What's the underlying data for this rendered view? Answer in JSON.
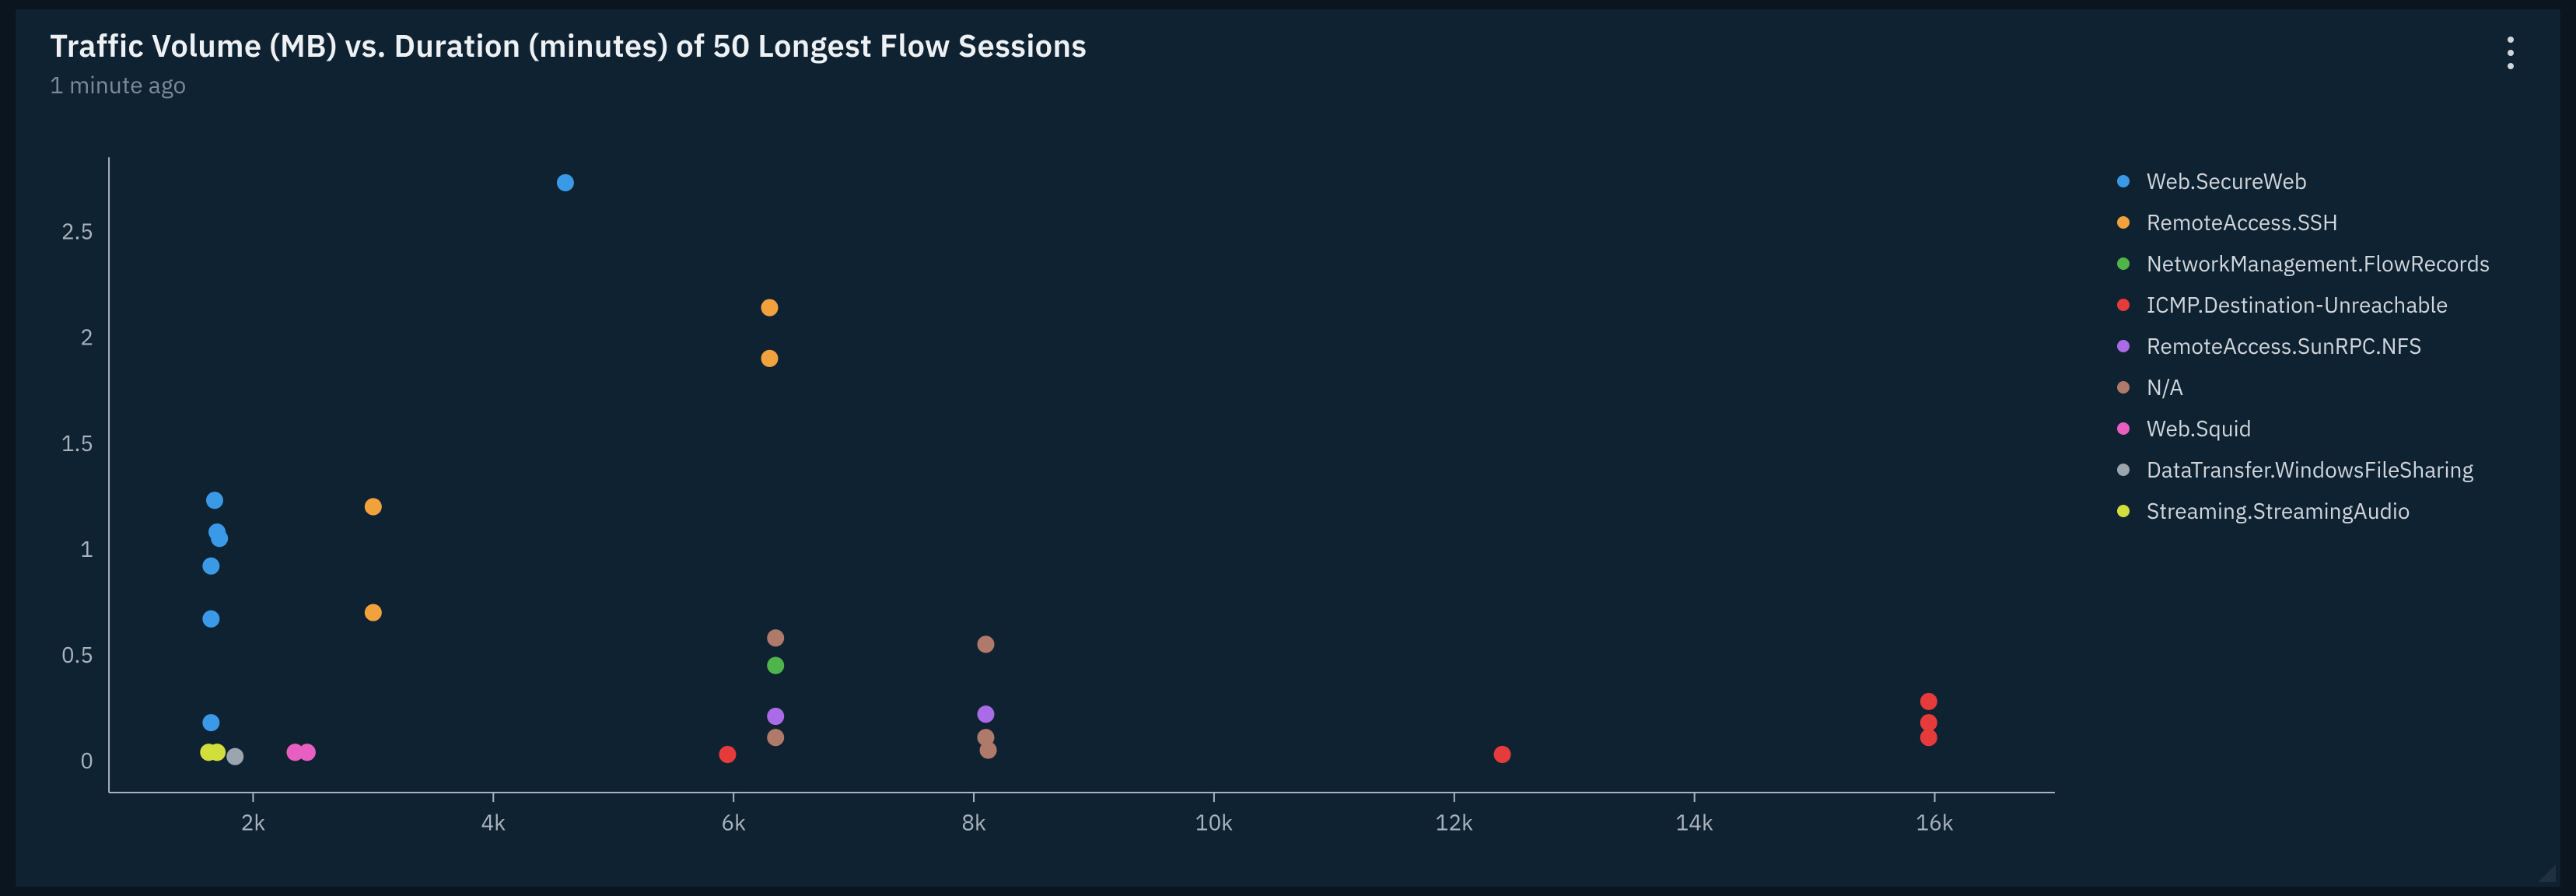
{
  "header": {
    "title": "Traffic Volume (MB) vs. Duration (minutes) of 50 Longest Flow Sessions",
    "subtitle": "1 minute ago"
  },
  "legend": [
    {
      "key": "Web.SecureWeb",
      "label": "Web.SecureWeb",
      "color": "#3a9ae8"
    },
    {
      "key": "RemoteAccess.SSH",
      "label": "RemoteAccess.SSH",
      "color": "#f2a23c"
    },
    {
      "key": "NetworkManagement.FlowRecords",
      "label": "NetworkManagement.FlowRecords",
      "color": "#4fb54a"
    },
    {
      "key": "ICMP.Destination-Unreachable",
      "label": "ICMP.Destination-Unreachable",
      "color": "#e63b3b"
    },
    {
      "key": "RemoteAccess.SunRPC.NFS",
      "label": "RemoteAccess.SunRPC.NFS",
      "color": "#a96ce6"
    },
    {
      "key": "N/A",
      "label": "N/A",
      "color": "#b07a6a"
    },
    {
      "key": "Web.Squid",
      "label": "Web.Squid",
      "color": "#e85ec1"
    },
    {
      "key": "DataTransfer.WindowsFileSharing",
      "label": "DataTransfer.WindowsFileSharing",
      "color": "#9aa5ad"
    },
    {
      "key": "Streaming.StreamingAudio",
      "label": "Streaming.StreamingAudio",
      "color": "#d2de3b"
    }
  ],
  "chart_data": {
    "type": "scatter",
    "xlabel": "",
    "ylabel": "",
    "title": "Traffic Volume (MB) vs. Duration (minutes) of 50 Longest Flow Sessions",
    "xlim": [
      800,
      17000
    ],
    "ylim": [
      -0.15,
      2.85
    ],
    "x_ticks": [
      2000,
      4000,
      6000,
      8000,
      10000,
      12000,
      14000,
      16000
    ],
    "x_tick_labels": [
      "2k",
      "4k",
      "6k",
      "8k",
      "10k",
      "12k",
      "14k",
      "16k"
    ],
    "y_ticks": [
      0,
      0.5,
      1,
      1.5,
      2,
      2.5
    ],
    "y_tick_labels": [
      "0",
      "0.5",
      "1",
      "1.5",
      "2",
      "2.5"
    ],
    "series": {
      "Web.SecureWeb": [
        {
          "x": 1650,
          "y": 0.18
        },
        {
          "x": 1650,
          "y": 0.67
        },
        {
          "x": 1650,
          "y": 0.92
        },
        {
          "x": 1700,
          "y": 1.08
        },
        {
          "x": 1720,
          "y": 1.05
        },
        {
          "x": 1680,
          "y": 1.23
        },
        {
          "x": 4600,
          "y": 2.73
        }
      ],
      "RemoteAccess.SSH": [
        {
          "x": 3000,
          "y": 0.7
        },
        {
          "x": 3000,
          "y": 1.2
        },
        {
          "x": 6300,
          "y": 1.9
        },
        {
          "x": 6300,
          "y": 2.14
        }
      ],
      "NetworkManagement.FlowRecords": [
        {
          "x": 6350,
          "y": 0.45
        }
      ],
      "ICMP.Destination-Unreachable": [
        {
          "x": 5950,
          "y": 0.03
        },
        {
          "x": 12400,
          "y": 0.03
        },
        {
          "x": 15950,
          "y": 0.11
        },
        {
          "x": 15950,
          "y": 0.18
        },
        {
          "x": 15950,
          "y": 0.28
        }
      ],
      "RemoteAccess.SunRPC.NFS": [
        {
          "x": 6350,
          "y": 0.21
        },
        {
          "x": 8100,
          "y": 0.22
        }
      ],
      "N/A": [
        {
          "x": 1700,
          "y": 0.04
        },
        {
          "x": 6350,
          "y": 0.11
        },
        {
          "x": 6350,
          "y": 0.58
        },
        {
          "x": 8120,
          "y": 0.05
        },
        {
          "x": 8100,
          "y": 0.11
        },
        {
          "x": 8100,
          "y": 0.55
        }
      ],
      "Web.Squid": [
        {
          "x": 2350,
          "y": 0.04
        },
        {
          "x": 2450,
          "y": 0.04
        }
      ],
      "DataTransfer.WindowsFileSharing": [
        {
          "x": 1850,
          "y": 0.02
        }
      ],
      "Streaming.StreamingAudio": [
        {
          "x": 1630,
          "y": 0.04
        },
        {
          "x": 1700,
          "y": 0.04
        }
      ]
    }
  }
}
